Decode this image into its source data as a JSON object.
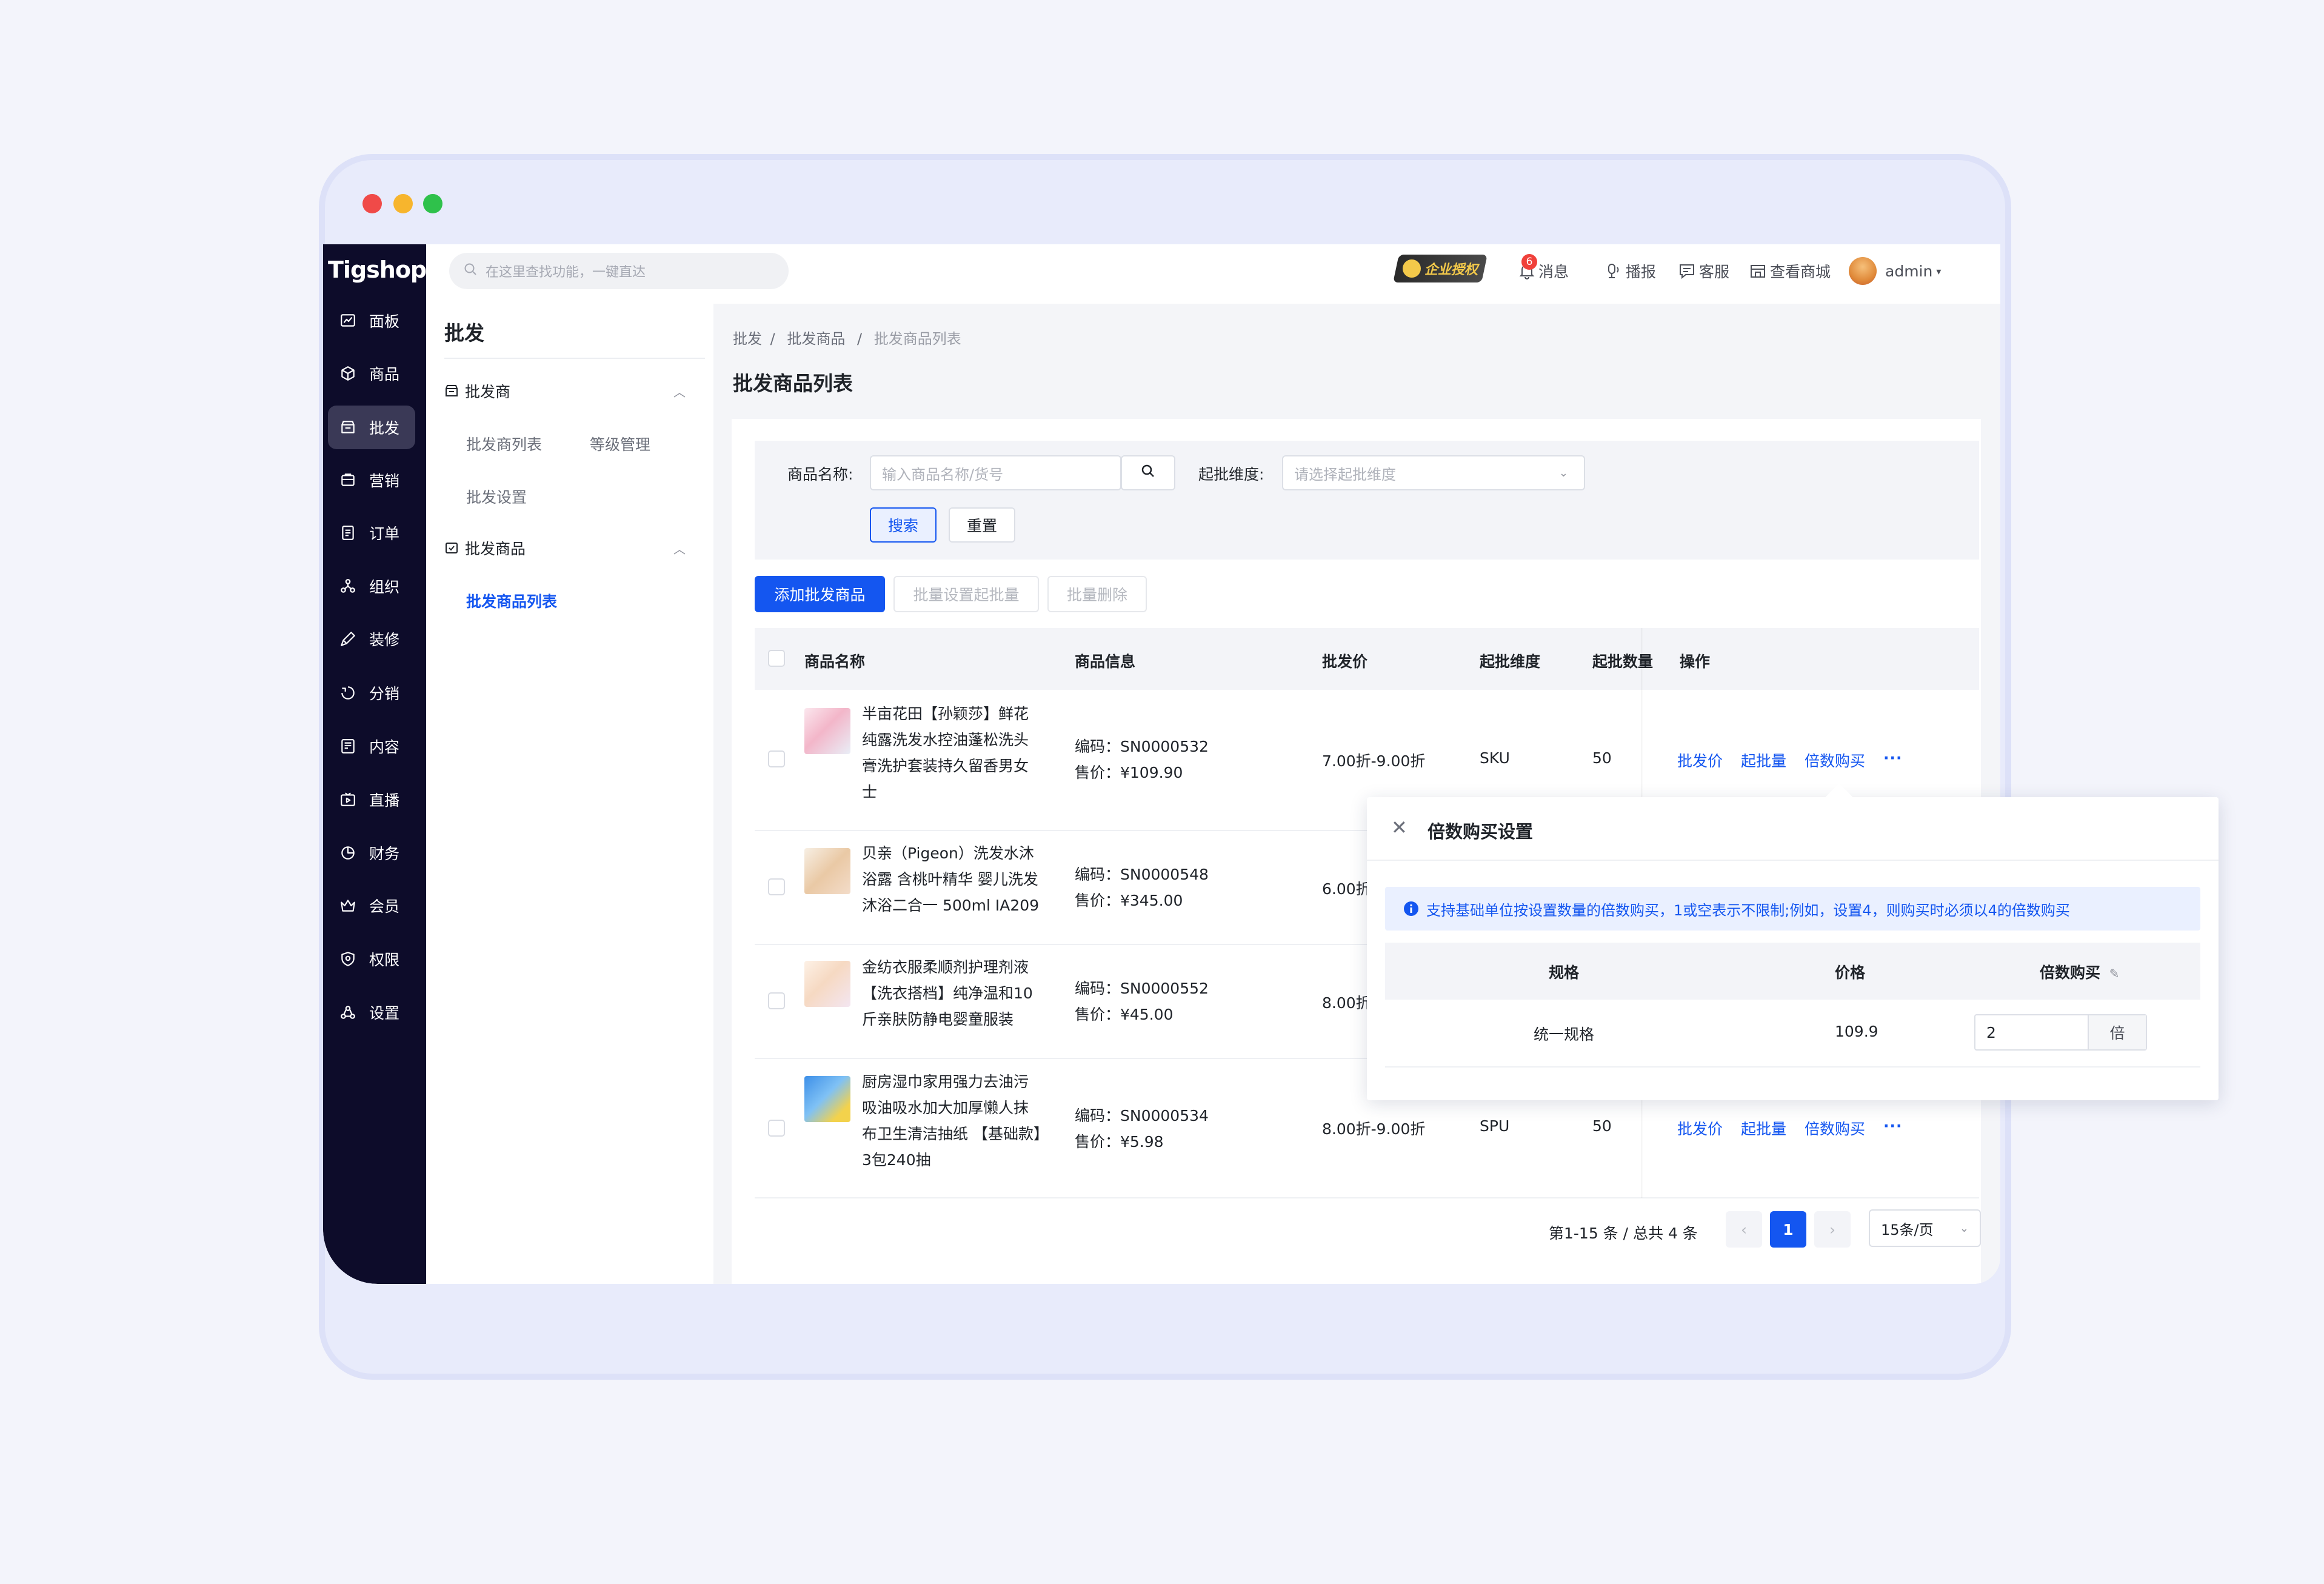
{
  "window": {
    "dots": [
      "#f04a48",
      "#f7b52d",
      "#2fc14b"
    ]
  },
  "brand": {
    "logo": "Tigshop"
  },
  "sidebar": {
    "items": [
      {
        "label": "面板",
        "icon": "dashboard-icon"
      },
      {
        "label": "商品",
        "icon": "box-icon"
      },
      {
        "label": "批发",
        "icon": "store-icon"
      },
      {
        "label": "营销",
        "icon": "shop-icon"
      },
      {
        "label": "订单",
        "icon": "order-icon"
      },
      {
        "label": "组织",
        "icon": "org-icon"
      },
      {
        "label": "装修",
        "icon": "brush-icon"
      },
      {
        "label": "分销",
        "icon": "share-icon"
      },
      {
        "label": "内容",
        "icon": "content-icon"
      },
      {
        "label": "直播",
        "icon": "live-icon"
      },
      {
        "label": "财务",
        "icon": "finance-icon"
      },
      {
        "label": "会员",
        "icon": "crown-icon"
      },
      {
        "label": "权限",
        "icon": "shield-icon"
      },
      {
        "label": "设置",
        "icon": "settings-icon"
      }
    ],
    "active_index": 2
  },
  "topbar": {
    "search_placeholder": "在这里查找功能，一键直达",
    "badge_label": "企业授权",
    "message_label": "消息",
    "message_count": "6",
    "broadcast_label": "播报",
    "service_label": "客服",
    "mall_label": "查看商城",
    "user_label": "admin"
  },
  "subnav": {
    "title": "批发",
    "group1": {
      "label": "批发商",
      "items": [
        "批发商列表",
        "等级管理",
        "批发设置"
      ]
    },
    "group2": {
      "label": "批发商品",
      "items": [
        "批发商品列表"
      ]
    }
  },
  "breadcrumb": [
    "批发",
    "批发商品",
    "批发商品列表"
  ],
  "page_title": "批发商品列表",
  "filter": {
    "name_label": "商品名称:",
    "name_placeholder": "输入商品名称/货号",
    "dim_label": "起批维度:",
    "dim_placeholder": "请选择起批维度",
    "search_btn": "搜索",
    "reset_btn": "重置"
  },
  "actions": {
    "add": "添加批发商品",
    "batch_set": "批量设置起批量",
    "batch_delete": "批量删除"
  },
  "table": {
    "headers": [
      "商品名称",
      "商品信息",
      "批发价",
      "起批维度",
      "起批数量",
      "操作"
    ],
    "ops": [
      "批发价",
      "起批量",
      "倍数购买",
      "···"
    ],
    "rows": [
      {
        "name": [
          "半亩花田【孙颖莎】鲜花",
          "纯露洗发水控油蓬松洗头",
          "膏洗护套装持久留香男女",
          "士"
        ],
        "code": "编码：SN0000532",
        "price": "售价：¥109.90",
        "wholesale": "7.00折-9.00折",
        "dim": "SKU",
        "qty": "50"
      },
      {
        "name": [
          "贝亲（Pigeon）洗发水沐",
          "浴露 含桃叶精华 婴儿洗发",
          "沐浴二合一 500ml IA209"
        ],
        "code": "编码：SN0000548",
        "price": "售价：¥345.00",
        "wholesale": "6.00折",
        "dim": "",
        "qty": ""
      },
      {
        "name": [
          "金纺衣服柔顺剂护理剂液",
          "【洗衣搭档】纯净温和10",
          "斤亲肤防静电婴童服装"
        ],
        "code": "编码：SN0000552",
        "price": "售价：¥45.00",
        "wholesale": "8.00折",
        "dim": "",
        "qty": ""
      },
      {
        "name": [
          "厨房湿巾家用强力去油污",
          "吸油吸水加大加厚懒人抹",
          "布卫生清洁抽纸 【基础款】",
          "3包240抽"
        ],
        "code": "编码：SN0000534",
        "price": "售价：¥5.98",
        "wholesale": "8.00折-9.00折",
        "dim": "SPU",
        "qty": "50"
      }
    ]
  },
  "pagination": {
    "summary": "第1-15 条 / 总共 4 条",
    "prev": "‹",
    "current": "1",
    "next": "›",
    "page_size": "15条/页"
  },
  "popover": {
    "title": "倍数购买设置",
    "close": "✕",
    "alert": "支持基础单位按设置数量的倍数购买，1或空表示不限制;例如，设置4，则购买时必须以4的倍数购买",
    "headers": [
      "规格",
      "价格",
      "倍数购买"
    ],
    "row": {
      "spec": "统一规格",
      "price": "109.9",
      "multiple": "2",
      "unit": "倍"
    }
  },
  "colors": {
    "primary": "#1456f0",
    "sidebar_bg": "#0d0c2a",
    "badge_red": "#f0413b"
  }
}
